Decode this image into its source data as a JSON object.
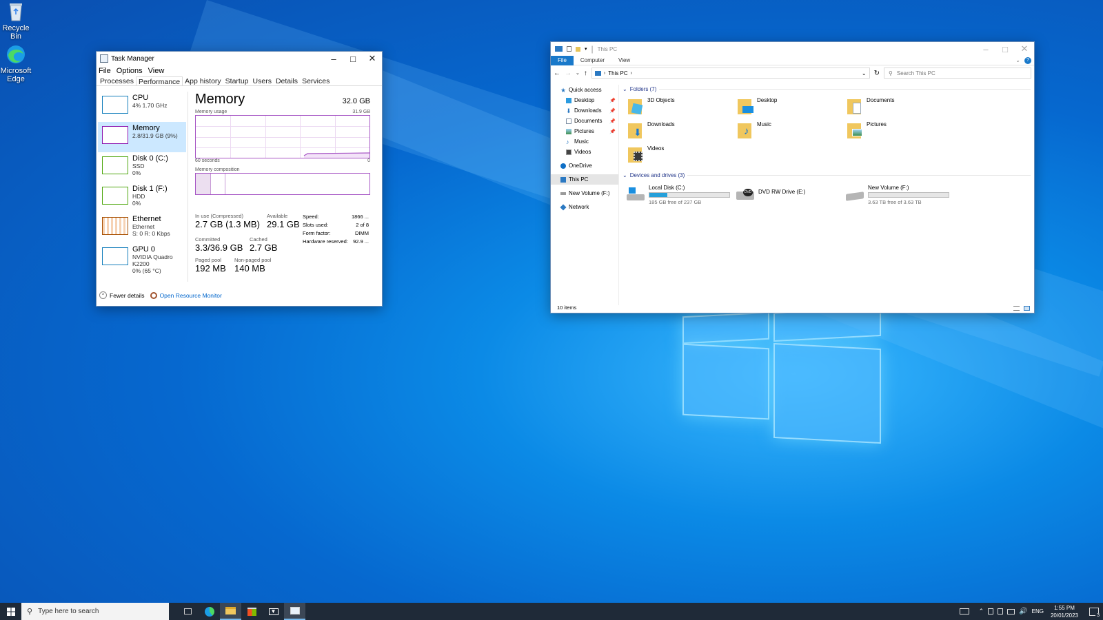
{
  "desktop": {
    "icons": [
      {
        "label": "Recycle Bin"
      },
      {
        "label": "Microsoft Edge"
      }
    ]
  },
  "task_manager": {
    "title": "Task Manager",
    "menu": [
      "File",
      "Options",
      "View"
    ],
    "tabs": [
      "Processes",
      "Performance",
      "App history",
      "Startup",
      "Users",
      "Details",
      "Services"
    ],
    "active_tab": "Performance",
    "side_items": [
      {
        "name": "CPU",
        "sub1": "4% 1.70 GHz",
        "sub2": "",
        "color": "#117dbb"
      },
      {
        "name": "Memory",
        "sub1": "2.8/31.9 GB (9%)",
        "sub2": "",
        "color": "#8b12ae"
      },
      {
        "name": "Disk 0 (C:)",
        "sub1": "SSD",
        "sub2": "0%",
        "color": "#4da60c"
      },
      {
        "name": "Disk 1 (F:)",
        "sub1": "HDD",
        "sub2": "0%",
        "color": "#4da60c"
      },
      {
        "name": "Ethernet",
        "sub1": "Ethernet",
        "sub2": "S: 0 R: 0 Kbps",
        "color": "#a74f01"
      },
      {
        "name": "GPU 0",
        "sub1": "NVIDIA Quadro K2200",
        "sub2": "0% (65 °C)",
        "color": "#117dbb"
      }
    ],
    "memory": {
      "title": "Memory",
      "total": "32.0 GB",
      "usage_label": "Memory usage",
      "usage_max": "31.9 GB",
      "axis_left": "60 seconds",
      "axis_right": "0",
      "composition_label": "Memory composition",
      "in_use_label": "In use (Compressed)",
      "in_use_value": "2.7 GB (1.3 MB)",
      "available_label": "Available",
      "available_value": "29.1 GB",
      "committed_label": "Committed",
      "committed_value": "3.3/36.9 GB",
      "cached_label": "Cached",
      "cached_value": "2.7 GB",
      "paged_label": "Paged pool",
      "paged_value": "192 MB",
      "nonpaged_label": "Non-paged pool",
      "nonpaged_value": "140 MB",
      "speed_label": "Speed:",
      "speed_value": "1866 ...",
      "slots_label": "Slots used:",
      "slots_value": "2 of 8",
      "form_label": "Form factor:",
      "form_value": "DIMM",
      "reserved_label": "Hardware reserved:",
      "reserved_value": "92.9 ..."
    },
    "footer": {
      "fewer": "Fewer details",
      "resource_monitor": "Open Resource Monitor"
    }
  },
  "explorer": {
    "title": "This PC",
    "ribbon": [
      "File",
      "Computer",
      "View"
    ],
    "address": "This PC",
    "search_placeholder": "Search This PC",
    "nav": [
      {
        "label": "Quick access",
        "level": 0,
        "pinned": false
      },
      {
        "label": "Desktop",
        "level": 1,
        "pinned": true
      },
      {
        "label": "Downloads",
        "level": 1,
        "pinned": true
      },
      {
        "label": "Documents",
        "level": 1,
        "pinned": true
      },
      {
        "label": "Pictures",
        "level": 1,
        "pinned": true
      },
      {
        "label": "Music",
        "level": 1,
        "pinned": false
      },
      {
        "label": "Videos",
        "level": 1,
        "pinned": false
      },
      {
        "label": "OneDrive",
        "level": 0,
        "pinned": false
      },
      {
        "label": "This PC",
        "level": 0,
        "pinned": false
      },
      {
        "label": "New Volume (F:)",
        "level": 0,
        "pinned": false
      },
      {
        "label": "Network",
        "level": 0,
        "pinned": false
      }
    ],
    "folders_header": "Folders (7)",
    "folders": [
      "3D Objects",
      "Desktop",
      "Documents",
      "Downloads",
      "Music",
      "Pictures",
      "Videos"
    ],
    "drives_header": "Devices and drives (3)",
    "drives": [
      {
        "name": "Local Disk (C:)",
        "free": "185 GB free of 237 GB",
        "used_fraction": 0.22,
        "has_bar": true
      },
      {
        "name": "DVD RW Drive (E:)",
        "free": "",
        "used_fraction": 0,
        "has_bar": false
      },
      {
        "name": "New Volume (F:)",
        "free": "3.63 TB free of 3.63 TB",
        "used_fraction": 0.0,
        "has_bar": true
      }
    ],
    "status": "10 items"
  },
  "taskbar": {
    "search_placeholder": "Type here to search",
    "tray_lang": "ENG",
    "time": "1:55 PM",
    "date": "20/01/2023",
    "notifications": "3"
  }
}
